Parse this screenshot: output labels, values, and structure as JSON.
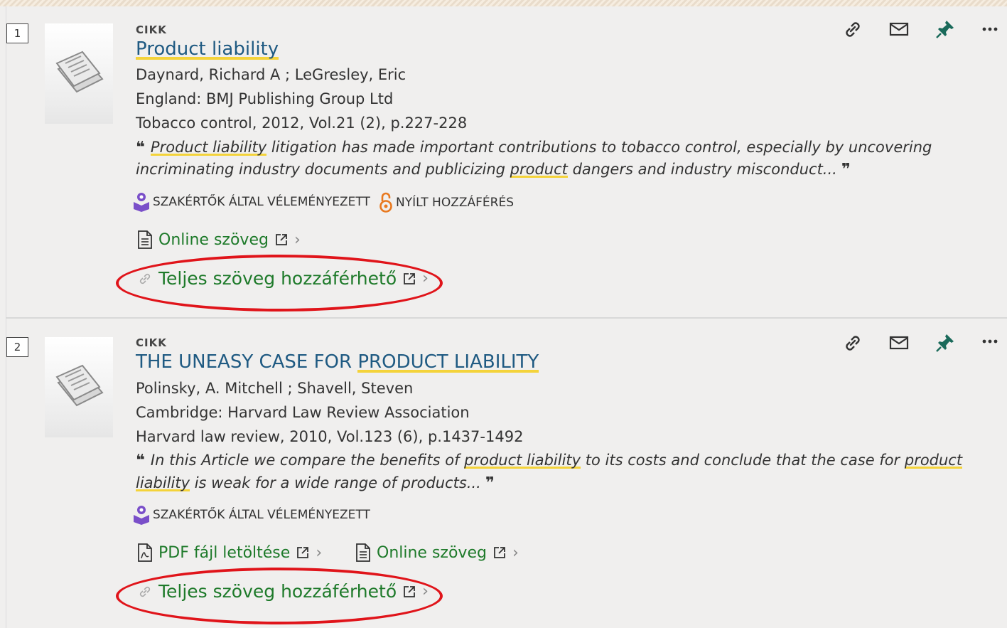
{
  "results": [
    {
      "number": "1",
      "type": "CIKK",
      "title_parts": [
        "",
        "Product liability",
        ""
      ],
      "authors": "Daynard, Richard A ; LeGresley, Eric",
      "publisher": "England: BMJ Publishing Group Ltd",
      "source": "Tobacco control, 2012, Vol.21 (2), p.227-228",
      "snippet_line1": [
        "Product liability",
        " litigation has made important contributions to tobacco control, especially by uncovering"
      ],
      "snippet_line2": [
        "incriminating industry documents and publicizing ",
        "product",
        " dangers and industry misconduct..."
      ],
      "badges": [
        "SZAKÉRTŐK ÁLTAL VÉLEMÉNYEZETT",
        "NYÍLT HOZZÁFÉRÉS"
      ],
      "links": [
        "Online szöveg"
      ],
      "fulltext": "Teljes szöveg hozzáférhető"
    },
    {
      "number": "2",
      "type": "CIKK",
      "title_parts": [
        "THE UNEASY CASE FOR ",
        "PRODUCT LIABILITY",
        ""
      ],
      "authors": "Polinsky, A. Mitchell ; Shavell, Steven",
      "publisher": "Cambridge: Harvard Law Review Association",
      "source": "Harvard law review, 2010, Vol.123 (6), p.1437-1492",
      "snippet_line1": [
        "In this Article we compare the benefits of ",
        "product liability",
        " to its costs and conclude that the case for ",
        "product"
      ],
      "snippet_line2": [
        "liability",
        " is weak for a wide range of products..."
      ],
      "badges": [
        "SZAKÉRTŐK ÁLTAL VÉLEMÉNYEZETT"
      ],
      "links": [
        "PDF fájl letöltése",
        "Online szöveg"
      ],
      "fulltext": "Teljes szöveg hozzáférhető"
    }
  ],
  "icons": {
    "actions": [
      "link-icon",
      "mail-icon",
      "pin-icon",
      "more-icon"
    ],
    "badge_peer": "peer-reviewed-icon",
    "badge_open": "open-access-icon",
    "quote": "quote-icon"
  },
  "colors": {
    "title": "#1f5a82",
    "link": "#1e7a2a",
    "highlight": "#f4d33a",
    "annotation": "#e0141a",
    "pin": "#1a6a5a",
    "peer_reviewed": "#7a4fc9",
    "open_access": "#e8781e"
  }
}
